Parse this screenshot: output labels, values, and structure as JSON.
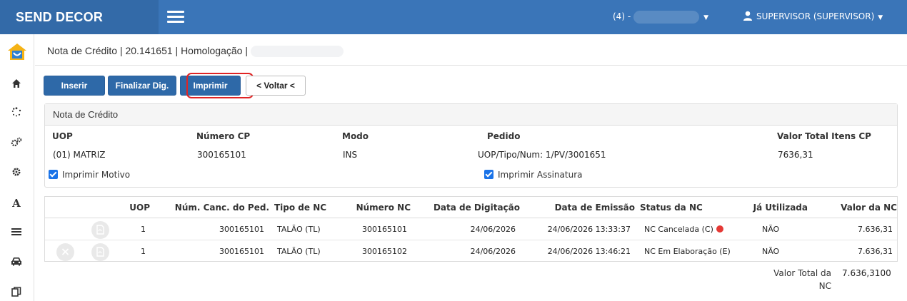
{
  "app": {
    "brand": "SEND DECOR"
  },
  "header": {
    "company_prefix": "(4) -",
    "user": "SUPERVISOR (SUPERVISOR)"
  },
  "page": {
    "title": "Nota de Crédito | 20.141651 | Homologação |"
  },
  "toolbar": {
    "inserir": "Inserir",
    "finalizar": "Finalizar Dig.",
    "imprimir": "Imprimir",
    "voltar": "< Voltar <"
  },
  "panel": {
    "title": "Nota de Crédito",
    "labels": {
      "uop": "UOP",
      "numero_cp": "Número CP",
      "modo": "Modo",
      "pedido": "Pedido",
      "valor_total": "Valor Total Itens CP"
    },
    "values": {
      "uop": "(01) MATRIZ",
      "numero_cp": "300165101",
      "modo": "INS",
      "pedido": "UOP/Tipo/Num: 1/PV/3001651",
      "valor_total": "7636,31"
    },
    "checkboxes": {
      "motivo": "Imprimir Motivo",
      "assinatura": "Imprimir Assinatura"
    }
  },
  "table": {
    "columns": [
      "UOP",
      "Núm. Canc. do Ped.",
      "Tipo de NC",
      "Número NC",
      "Data de Digitação",
      "Data de Emissão",
      "Status da NC",
      "Já Utilizada",
      "Valor da NC"
    ],
    "rows": [
      {
        "uop": "1",
        "num_canc": "300165101",
        "tipo": "TALÃO (TL)",
        "numero": "300165101",
        "data_dig": "24/06/2026",
        "data_emi": "24/06/2026 13:33:37",
        "status": "NC Cancelada (C)",
        "utilizada": "NÃO",
        "valor": "7.636,31"
      },
      {
        "uop": "1",
        "num_canc": "300165101",
        "tipo": "TALÃO (TL)",
        "numero": "300165102",
        "data_dig": "24/06/2026",
        "data_emi": "24/06/2026 13:46:21",
        "status": "NC Em Elaboração (E)",
        "utilizada": "NÃO",
        "valor": "7.636,31"
      }
    ]
  },
  "totals": {
    "label": "Valor Total da NC",
    "value": "7.636,3100"
  },
  "colors": {
    "topbar": "#3a75b8",
    "brand_bg": "#336aa8",
    "button_blue": "#2e69a8",
    "highlight_red": "#e02424",
    "status_red": "#e53935",
    "checkbox_blue": "#1a73e8"
  },
  "icons": {
    "logo": "house-logo-icon",
    "sidebar": [
      "home-icon",
      "spinner-icon",
      "gears-icon",
      "gear-icon",
      "font-icon",
      "list-icon",
      "car-icon",
      "copy-icon"
    ]
  }
}
